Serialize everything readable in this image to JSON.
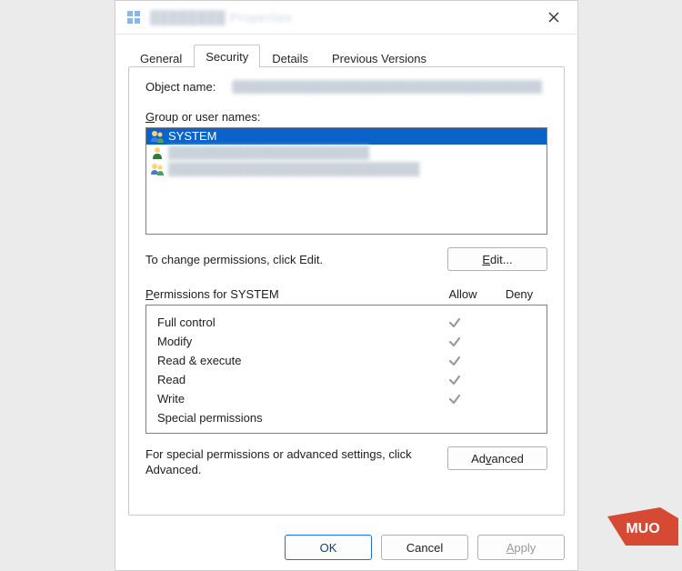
{
  "titlebar": {
    "title_blur": "████████ Properties"
  },
  "tabs": {
    "items": [
      "General",
      "Security",
      "Details",
      "Previous Versions"
    ],
    "active_index": 1
  },
  "object": {
    "label": "Object name:",
    "value_blur": "█████████████████████████████████████"
  },
  "groups": {
    "label_html": "Group or user names:",
    "items": [
      {
        "name": "SYSTEM",
        "icon": "group",
        "selected": true,
        "blurred": false
      },
      {
        "name": "████████████████████████",
        "icon": "user",
        "selected": false,
        "blurred": true
      },
      {
        "name": "██████████████████████████████",
        "icon": "group",
        "selected": false,
        "blurred": true
      }
    ]
  },
  "edit": {
    "hint": "To change permissions, click Edit.",
    "button_html": "Edit..."
  },
  "permissions": {
    "header_label": "Permissions for SYSTEM",
    "allow_label": "Allow",
    "deny_label": "Deny",
    "rows": [
      {
        "label": "Full control",
        "allow": true,
        "deny": false
      },
      {
        "label": "Modify",
        "allow": true,
        "deny": false
      },
      {
        "label": "Read & execute",
        "allow": true,
        "deny": false
      },
      {
        "label": "Read",
        "allow": true,
        "deny": false
      },
      {
        "label": "Write",
        "allow": true,
        "deny": false
      },
      {
        "label": "Special permissions",
        "allow": false,
        "deny": false
      }
    ]
  },
  "advanced": {
    "text": "For special permissions or advanced settings, click Advanced.",
    "button_html": "Advanced"
  },
  "buttons": {
    "ok": "OK",
    "cancel": "Cancel",
    "apply": "Apply"
  },
  "watermark": "MUO"
}
